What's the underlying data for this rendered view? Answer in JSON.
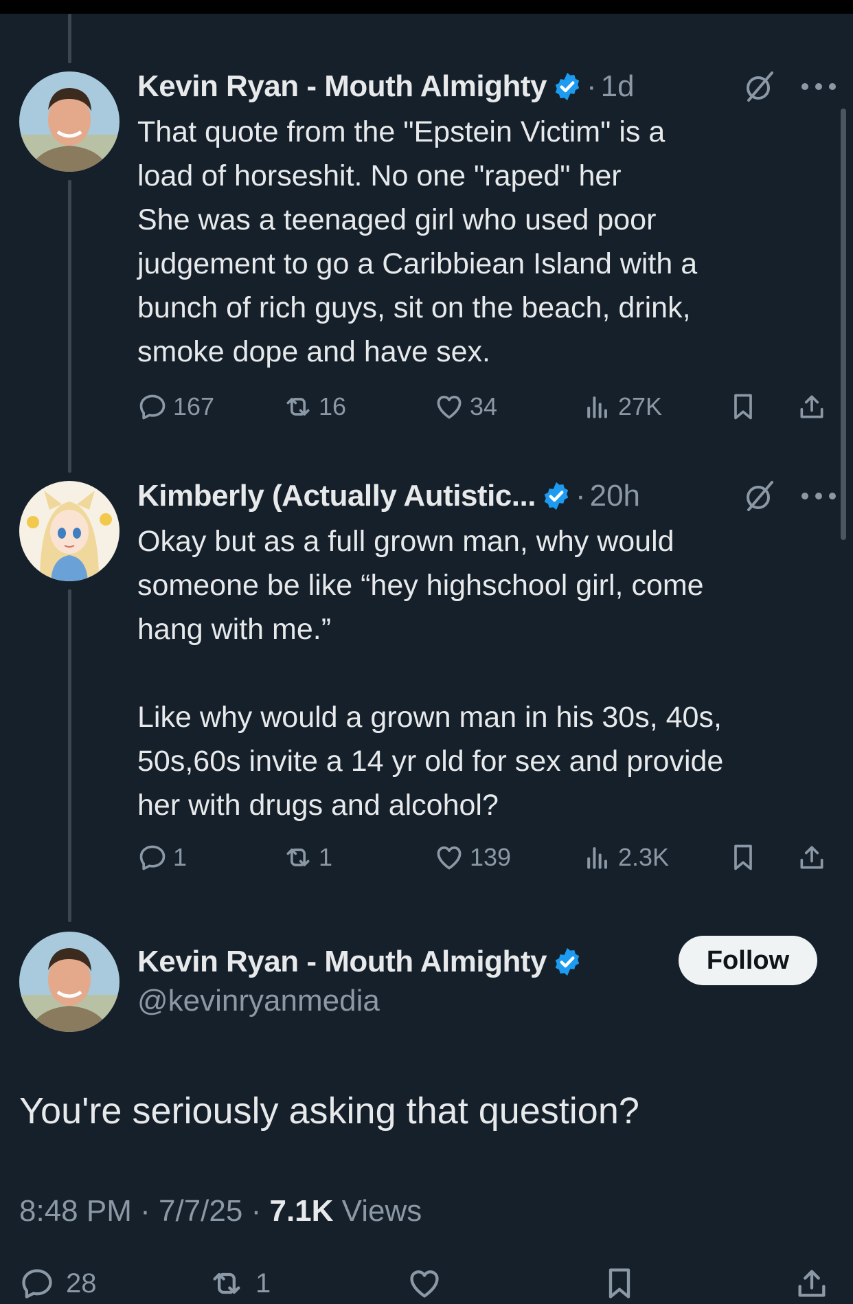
{
  "thread": [
    {
      "author": "Kevin Ryan - Mouth Almighty",
      "time": "1d",
      "text": "That quote from the \"Epstein Victim\" is a\nload of horseshit.  No one \"raped\" her\nShe was a teenaged girl who used poor\njudgement to go a Caribbiean Island with a\nbunch of rich guys, sit on the beach, drink,\nsmoke dope and have sex.",
      "stats": {
        "replies": "167",
        "reposts": "16",
        "likes": "34",
        "views": "27K"
      }
    },
    {
      "author": "Kimberly (Actually Autistic...",
      "time": "20h",
      "text": "Okay but as a full grown man, why would\nsomeone be like “hey highschool girl, come\nhang with me.”\n\nLike why would a grown man in his 30s, 40s,\n50s,60s invite a 14 yr old for sex and provide\nher with drugs and alcohol?",
      "stats": {
        "replies": "1",
        "reposts": "1",
        "likes": "139",
        "views": "2.3K"
      }
    }
  ],
  "main_tweet": {
    "author": "Kevin Ryan - Mouth Almighty",
    "handle": "@kevinryanmedia",
    "follow_label": "Follow",
    "text": "You're seriously asking that question?",
    "time": "8:48 PM",
    "date": "7/7/25",
    "views_count": "7.1K",
    "views_label": "Views",
    "stats": {
      "replies": "28",
      "reposts": "1"
    }
  },
  "separator": "·",
  "colors": {
    "background": "#15202b",
    "verified": "#1d9bf0",
    "muted": "#8b98a5",
    "text": "#e7e9ea"
  }
}
